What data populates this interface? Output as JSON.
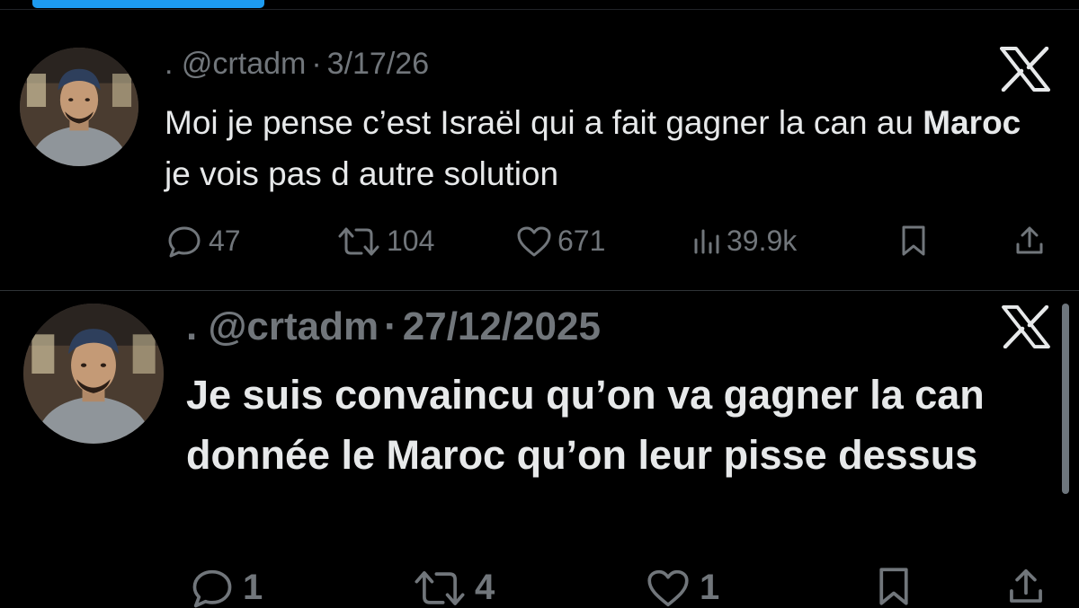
{
  "tweets": [
    {
      "display_name": ".",
      "handle": "@crtadm",
      "separator": "·",
      "date": "3/17/26",
      "text_before": "Moi je pense c’est Israël qui a fait gagner la can au ",
      "text_bold": "Maroc",
      "text_after": " je vois pas d autre solution",
      "replies": "47",
      "reposts": "104",
      "likes": "671",
      "views": "39.9k",
      "icons": [
        "x-logo",
        "reply-icon",
        "repost-icon",
        "like-icon",
        "views-icon",
        "bookmark-icon",
        "share-icon"
      ]
    },
    {
      "display_name": ".",
      "handle": "@crtadm",
      "separator": "·",
      "date": "27/12/2025",
      "text": "Je suis convaincu qu’on va gagner la can donnée le Maroc qu’on leur pisse dessus",
      "replies": "1",
      "reposts": "4",
      "likes": "1",
      "icons": [
        "x-logo",
        "reply-icon",
        "repost-icon",
        "like-icon",
        "bookmark-icon",
        "share-icon"
      ]
    }
  ],
  "colors": {
    "background": "#000000",
    "text": "#e7e9ea",
    "muted": "#71767b",
    "accent": "#1d9bf0",
    "divider": "#2f3336"
  }
}
